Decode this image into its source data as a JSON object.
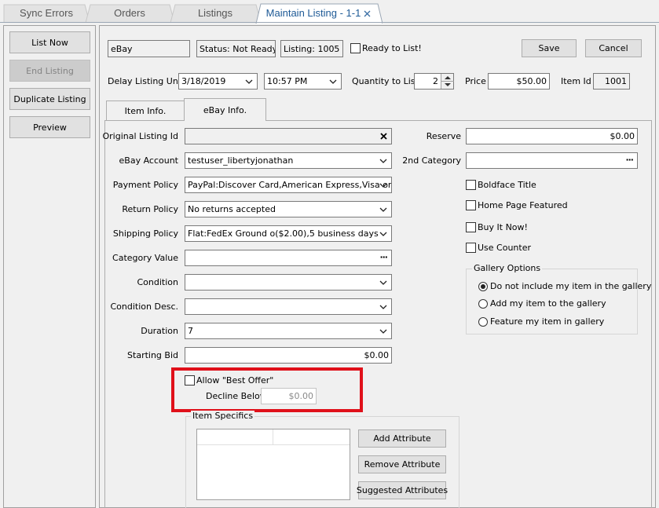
{
  "tabs": [
    {
      "label": "Sync Errors"
    },
    {
      "label": "Orders"
    },
    {
      "label": "Listings"
    },
    {
      "label": "Maintain Listing - 1-1",
      "active": true
    }
  ],
  "left_buttons": {
    "list_now": "List Now",
    "end_listing": "End Listing",
    "duplicate_listing": "Duplicate Listing",
    "preview": "Preview"
  },
  "header": {
    "marketplace": "eBay",
    "status": "Status: Not Ready",
    "listing": "Listing: 1005",
    "ready_label": "Ready to List!",
    "save": "Save",
    "cancel": "Cancel"
  },
  "schedule": {
    "delay_label": "Delay Listing Until",
    "date": "3/18/2019",
    "time": "10:57 PM",
    "quantity_label": "Quantity to List",
    "quantity": "2",
    "price_label": "Price",
    "price": "$50.00",
    "item_id_label": "Item Id",
    "item_id": "1001"
  },
  "subtabs": [
    {
      "label": "Item Info."
    },
    {
      "label": "eBay Info.",
      "active": true
    }
  ],
  "form": {
    "original_listing_id": {
      "label": "Original Listing Id",
      "value": ""
    },
    "ebay_account": {
      "label": "eBay Account",
      "value": "testuser_libertyjonathan"
    },
    "payment_policy": {
      "label": "Payment Policy",
      "value": "PayPal:Discover Card,American Express,Visa or"
    },
    "return_policy": {
      "label": "Return Policy",
      "value": "No returns accepted"
    },
    "shipping_policy": {
      "label": "Shipping Policy",
      "value": "Flat:FedEx Ground o($2.00),5 business days"
    },
    "category_value": {
      "label": "Category Value",
      "value": ""
    },
    "condition": {
      "label": "Condition",
      "value": ""
    },
    "condition_desc": {
      "label": "Condition Desc.",
      "value": ""
    },
    "duration": {
      "label": "Duration",
      "value": "7"
    },
    "starting_bid": {
      "label": "Starting Bid",
      "value": "$0.00"
    }
  },
  "best_offer": {
    "allow_label": "Allow \"Best Offer\"",
    "decline_label": "Decline Below",
    "decline_value": "$0.00",
    "highlight_color": "#e0101a"
  },
  "item_specifics": {
    "title": "Item Specifics",
    "add": "Add Attribute",
    "remove": "Remove Attribute",
    "suggested": "Suggested Attributes"
  },
  "right_form": {
    "reserve_label": "Reserve",
    "reserve_value": "$0.00",
    "second_category_label": "2nd Category",
    "second_category_value": "",
    "boldface": "Boldface Title",
    "home_page": "Home Page Featured",
    "buy_it_now": "Buy It Now!",
    "use_counter": "Use Counter"
  },
  "gallery": {
    "title": "Gallery Options",
    "options": [
      {
        "label": "Do not include my item in the gallery",
        "selected": true
      },
      {
        "label": "Add my item to the gallery",
        "selected": false
      },
      {
        "label": "Feature my item in gallery",
        "selected": false
      }
    ]
  }
}
